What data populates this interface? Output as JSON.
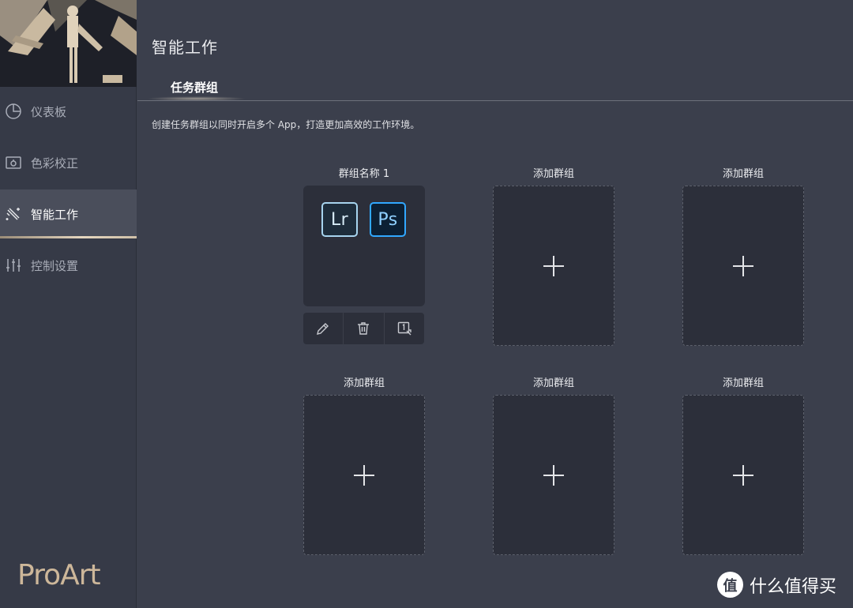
{
  "sidebar": {
    "items": [
      {
        "label": "仪表板",
        "icon": "dashboard-pie-icon"
      },
      {
        "label": "色彩校正",
        "icon": "color-calibration-icon"
      },
      {
        "label": "智能工作",
        "icon": "magic-wand-icon",
        "active": true
      },
      {
        "label": "控制设置",
        "icon": "sliders-icon"
      }
    ],
    "brand": "ProArt"
  },
  "main": {
    "title": "智能工作",
    "tab": "任务群组",
    "description": "创建任务群组以同时开启多个 App，打造更加高效的工作环境。",
    "groups": [
      {
        "label": "群组名称 1",
        "apps": [
          {
            "name": "Lr",
            "color": "#a7d4ee",
            "bg": "#1e2d3b"
          },
          {
            "name": "Ps",
            "color": "#31a8ff",
            "bg": "#0c2034"
          }
        ]
      },
      {
        "label": "添加群组"
      },
      {
        "label": "添加群组"
      },
      {
        "label": "添加群组"
      },
      {
        "label": "添加群组"
      },
      {
        "label": "添加群组"
      }
    ],
    "group_tools": [
      "edit-pencil-icon",
      "delete-trash-icon",
      "shortcut-key-icon"
    ]
  },
  "watermark": {
    "badge": "值",
    "text": "什么值得买"
  },
  "colors": {
    "background": "#3b3f4c",
    "sidebar": "#363a47",
    "card": "#2c2f3a",
    "accent": "#e5d6bf"
  }
}
